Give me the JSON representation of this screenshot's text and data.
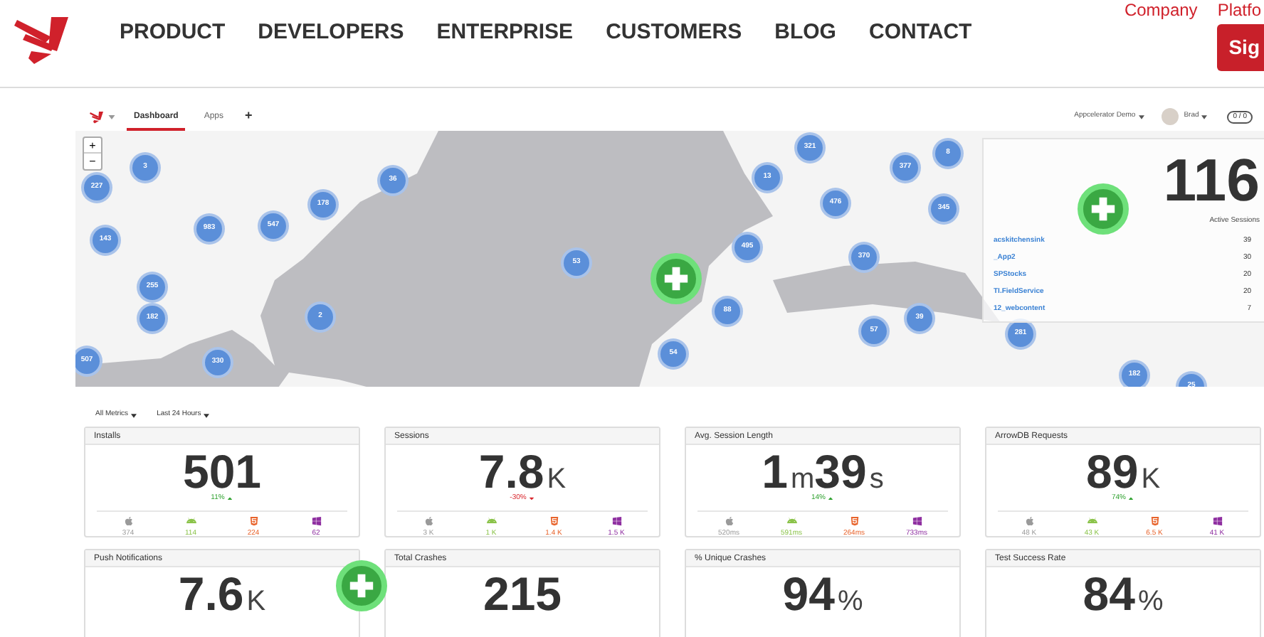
{
  "site_nav": {
    "items": [
      "PRODUCT",
      "DEVELOPERS",
      "ENTERPRISE",
      "CUSTOMERS",
      "BLOG",
      "CONTACT"
    ],
    "top_links": [
      "Company",
      "Platfo"
    ],
    "button": "Sig"
  },
  "dashboard": {
    "tabs": [
      {
        "label": "Dashboard",
        "selected": true
      },
      {
        "label": "Apps",
        "selected": false
      }
    ],
    "add": "+",
    "org": "Appcelerator Demo",
    "user": "Brad",
    "counter": "0 / 0"
  },
  "map": {
    "zoom_in": "+",
    "zoom_out": "−",
    "clusters": [
      "3",
      "227",
      "143",
      "983",
      "547",
      "178",
      "36",
      "255",
      "182",
      "2",
      "507",
      "330",
      "53",
      "321",
      "13",
      "377",
      "8",
      "476",
      "345",
      "495",
      "370",
      "88",
      "57",
      "39",
      "54",
      "281",
      "182",
      "25"
    ],
    "overlay": {
      "total": "116",
      "label": "Active Sessions",
      "apps": [
        {
          "name": "acskitchensink",
          "count": "39"
        },
        {
          "name": "_App2",
          "count": "30"
        },
        {
          "name": "SPStocks",
          "count": "20"
        },
        {
          "name": "TI.FieldService",
          "count": "20"
        },
        {
          "name": "12_webcontent",
          "count": "7"
        }
      ]
    }
  },
  "filters": [
    "All Metrics",
    "Last 24 Hours"
  ],
  "metrics": [
    {
      "title": "Installs",
      "value": [
        {
          "text": "501",
          "kind": "number"
        }
      ],
      "change": {
        "text": "11%",
        "rising": true
      },
      "platforms": [
        {
          "kind": "ios",
          "value": "374"
        },
        {
          "kind": "android",
          "value": "114"
        },
        {
          "kind": "html5",
          "value": "224"
        },
        {
          "kind": "windows",
          "value": "62"
        }
      ]
    },
    {
      "title": "Sessions",
      "value": [
        {
          "text": "7.8",
          "kind": "number"
        },
        {
          "text": "K",
          "kind": "unit"
        }
      ],
      "change": {
        "text": "-30%",
        "rising": false
      },
      "platforms": [
        {
          "kind": "ios",
          "value": "3 K"
        },
        {
          "kind": "android",
          "value": "1 K"
        },
        {
          "kind": "html5",
          "value": "1.4 K"
        },
        {
          "kind": "windows",
          "value": "1.5 K"
        }
      ]
    },
    {
      "title": "Avg. Session Length",
      "value": [
        {
          "text": "1",
          "kind": "number"
        },
        {
          "text": "m",
          "kind": "unit"
        },
        {
          "text": "39",
          "kind": "number"
        },
        {
          "text": "s",
          "kind": "unit"
        }
      ],
      "change": {
        "text": "14%",
        "rising": true
      },
      "platforms": [
        {
          "kind": "ios",
          "value": "520ms"
        },
        {
          "kind": "android",
          "value": "591ms"
        },
        {
          "kind": "html5",
          "value": "264ms"
        },
        {
          "kind": "windows",
          "value": "733ms"
        }
      ]
    },
    {
      "title": "ArrowDB Requests",
      "value": [
        {
          "text": "89",
          "kind": "number"
        },
        {
          "text": "K",
          "kind": "unit"
        }
      ],
      "change": {
        "text": "74%",
        "rising": true
      },
      "platforms": [
        {
          "kind": "ios",
          "value": "48 K"
        },
        {
          "kind": "android",
          "value": "43 K"
        },
        {
          "kind": "html5",
          "value": "6.5 K"
        },
        {
          "kind": "windows",
          "value": "41 K"
        }
      ]
    },
    {
      "title": "Push Notifications",
      "value": [
        {
          "text": "7.6",
          "kind": "number"
        },
        {
          "text": "K",
          "kind": "unit"
        }
      ]
    },
    {
      "title": "Total Crashes",
      "value": [
        {
          "text": "215",
          "kind": "number"
        }
      ]
    },
    {
      "title": "% Unique Crashes",
      "value": [
        {
          "text": "94",
          "kind": "number"
        },
        {
          "text": "%",
          "kind": "unit"
        }
      ]
    },
    {
      "title": "Test Success Rate",
      "value": [
        {
          "text": "84",
          "kind": "number"
        },
        {
          "text": "%",
          "kind": "unit"
        }
      ]
    }
  ]
}
